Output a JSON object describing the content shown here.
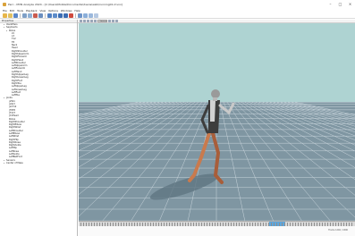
{
  "window": {
    "title": "Perc - MVN Analyze 2024 - [C:\\Users\\Mobile\\Documents\\Xsens\\walk\\running01.mvnx]",
    "controls": [
      "–",
      "□",
      "×"
    ]
  },
  "menu": [
    "File",
    "Edit",
    "Tools",
    "Playback",
    "View",
    "Options",
    "Windows",
    "Help"
  ],
  "tree": {
    "header": "Properties",
    "items": [
      {
        "label": "Identifiers",
        "depth": 1,
        "twisty": "▾"
      },
      {
        "label": "Segments",
        "depth": 1,
        "twisty": "▾"
      },
      {
        "label": "Pelvis",
        "depth": 2,
        "twisty": "▾"
      },
      {
        "label": "L5",
        "depth": 3,
        "twisty": ""
      },
      {
        "label": "L3",
        "depth": 3,
        "twisty": ""
      },
      {
        "label": "T12",
        "depth": 3,
        "twisty": ""
      },
      {
        "label": "T8",
        "depth": 3,
        "twisty": ""
      },
      {
        "label": "Neck",
        "depth": 3,
        "twisty": ""
      },
      {
        "label": "Head",
        "depth": 3,
        "twisty": ""
      },
      {
        "label": "RightShoulder",
        "depth": 3,
        "twisty": ""
      },
      {
        "label": "RightUpperArm",
        "depth": 3,
        "twisty": ""
      },
      {
        "label": "RightForeArm",
        "depth": 3,
        "twisty": ""
      },
      {
        "label": "RightHand",
        "depth": 3,
        "twisty": ""
      },
      {
        "label": "LeftShoulder",
        "depth": 3,
        "twisty": ""
      },
      {
        "label": "LeftUpperArm",
        "depth": 3,
        "twisty": ""
      },
      {
        "label": "LeftForeArm",
        "depth": 3,
        "twisty": ""
      },
      {
        "label": "LeftHand",
        "depth": 3,
        "twisty": ""
      },
      {
        "label": "RightUpperLeg",
        "depth": 3,
        "twisty": ""
      },
      {
        "label": "RightLowerLeg",
        "depth": 3,
        "twisty": ""
      },
      {
        "label": "RightFoot",
        "depth": 3,
        "twisty": ""
      },
      {
        "label": "RightToe",
        "depth": 3,
        "twisty": ""
      },
      {
        "label": "LeftUpperLeg",
        "depth": 3,
        "twisty": ""
      },
      {
        "label": "LeftLowerLeg",
        "depth": 3,
        "twisty": ""
      },
      {
        "label": "LeftFoot",
        "depth": 3,
        "twisty": ""
      },
      {
        "label": "LeftToe",
        "depth": 3,
        "twisty": ""
      },
      {
        "label": "Joints",
        "depth": 1,
        "twisty": "▾"
      },
      {
        "label": "jL5S1",
        "depth": 2,
        "twisty": ""
      },
      {
        "label": "jL4L3",
        "depth": 2,
        "twisty": ""
      },
      {
        "label": "jL1T12",
        "depth": 2,
        "twisty": ""
      },
      {
        "label": "jT9T8",
        "depth": 2,
        "twisty": ""
      },
      {
        "label": "jT1C7",
        "depth": 2,
        "twisty": ""
      },
      {
        "label": "jC1Head",
        "depth": 2,
        "twisty": ""
      },
      {
        "label": "Pelvis",
        "depth": 2,
        "twisty": ""
      },
      {
        "label": "RightShoulder",
        "depth": 2,
        "twisty": ""
      },
      {
        "label": "RightElbow",
        "depth": 2,
        "twisty": ""
      },
      {
        "label": "RightWrist",
        "depth": 2,
        "twisty": ""
      },
      {
        "label": "LeftShoulder",
        "depth": 2,
        "twisty": ""
      },
      {
        "label": "LeftElbow",
        "depth": 2,
        "twisty": ""
      },
      {
        "label": "LeftWrist",
        "depth": 2,
        "twisty": ""
      },
      {
        "label": "RightHip",
        "depth": 2,
        "twisty": ""
      },
      {
        "label": "RightKnee",
        "depth": 2,
        "twisty": ""
      },
      {
        "label": "RightAnkle",
        "depth": 2,
        "twisty": ""
      },
      {
        "label": "LeftHip",
        "depth": 2,
        "twisty": ""
      },
      {
        "label": "LeftKnee",
        "depth": 2,
        "twisty": ""
      },
      {
        "label": "LeftAnkle",
        "depth": 2,
        "twisty": ""
      },
      {
        "label": "LeftBallFoot",
        "depth": 2,
        "twisty": ""
      },
      {
        "label": "Sensors",
        "depth": 1,
        "twisty": "▸"
      },
      {
        "label": "Center of Mass",
        "depth": 1,
        "twisty": "▸"
      }
    ]
  },
  "viewport": {
    "camera_select": "Camera",
    "sky_color": "#aed3d2",
    "floor_color": "#7f96a2"
  },
  "timeline": {
    "position_fraction": 0.69
  },
  "status": {
    "frame_label": "Frame 1240 / 2400"
  }
}
